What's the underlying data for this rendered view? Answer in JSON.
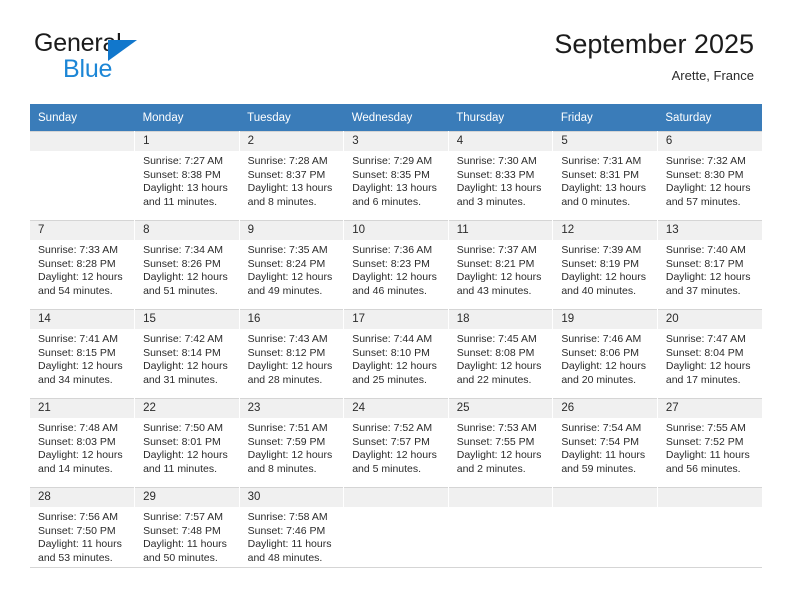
{
  "brand": {
    "name_top": "General",
    "name_bottom": "Blue",
    "triangle_color": "#1177cc",
    "blue_color": "#1c86d6"
  },
  "header": {
    "title": "September 2025",
    "location": "Arette, France"
  },
  "theme": {
    "header_row_bg": "#3a7cb9",
    "daynum_band_bg": "#f0f0f0",
    "grid_line": "#d5d5d5",
    "text": "#2b2b2b"
  },
  "weekday_headers": [
    "Sunday",
    "Monday",
    "Tuesday",
    "Wednesday",
    "Thursday",
    "Friday",
    "Saturday"
  ],
  "labels": {
    "sunrise_prefix": "Sunrise:",
    "sunset_prefix": "Sunset:",
    "daylight_prefix": "Daylight:"
  },
  "weeks": [
    [
      {
        "day": "",
        "sunrise": "",
        "sunset": "",
        "daylight": ""
      },
      {
        "day": "1",
        "sunrise": "Sunrise: 7:27 AM",
        "sunset": "Sunset: 8:38 PM",
        "daylight": "Daylight: 13 hours and 11 minutes."
      },
      {
        "day": "2",
        "sunrise": "Sunrise: 7:28 AM",
        "sunset": "Sunset: 8:37 PM",
        "daylight": "Daylight: 13 hours and 8 minutes."
      },
      {
        "day": "3",
        "sunrise": "Sunrise: 7:29 AM",
        "sunset": "Sunset: 8:35 PM",
        "daylight": "Daylight: 13 hours and 6 minutes."
      },
      {
        "day": "4",
        "sunrise": "Sunrise: 7:30 AM",
        "sunset": "Sunset: 8:33 PM",
        "daylight": "Daylight: 13 hours and 3 minutes."
      },
      {
        "day": "5",
        "sunrise": "Sunrise: 7:31 AM",
        "sunset": "Sunset: 8:31 PM",
        "daylight": "Daylight: 13 hours and 0 minutes."
      },
      {
        "day": "6",
        "sunrise": "Sunrise: 7:32 AM",
        "sunset": "Sunset: 8:30 PM",
        "daylight": "Daylight: 12 hours and 57 minutes."
      }
    ],
    [
      {
        "day": "7",
        "sunrise": "Sunrise: 7:33 AM",
        "sunset": "Sunset: 8:28 PM",
        "daylight": "Daylight: 12 hours and 54 minutes."
      },
      {
        "day": "8",
        "sunrise": "Sunrise: 7:34 AM",
        "sunset": "Sunset: 8:26 PM",
        "daylight": "Daylight: 12 hours and 51 minutes."
      },
      {
        "day": "9",
        "sunrise": "Sunrise: 7:35 AM",
        "sunset": "Sunset: 8:24 PM",
        "daylight": "Daylight: 12 hours and 49 minutes."
      },
      {
        "day": "10",
        "sunrise": "Sunrise: 7:36 AM",
        "sunset": "Sunset: 8:23 PM",
        "daylight": "Daylight: 12 hours and 46 minutes."
      },
      {
        "day": "11",
        "sunrise": "Sunrise: 7:37 AM",
        "sunset": "Sunset: 8:21 PM",
        "daylight": "Daylight: 12 hours and 43 minutes."
      },
      {
        "day": "12",
        "sunrise": "Sunrise: 7:39 AM",
        "sunset": "Sunset: 8:19 PM",
        "daylight": "Daylight: 12 hours and 40 minutes."
      },
      {
        "day": "13",
        "sunrise": "Sunrise: 7:40 AM",
        "sunset": "Sunset: 8:17 PM",
        "daylight": "Daylight: 12 hours and 37 minutes."
      }
    ],
    [
      {
        "day": "14",
        "sunrise": "Sunrise: 7:41 AM",
        "sunset": "Sunset: 8:15 PM",
        "daylight": "Daylight: 12 hours and 34 minutes."
      },
      {
        "day": "15",
        "sunrise": "Sunrise: 7:42 AM",
        "sunset": "Sunset: 8:14 PM",
        "daylight": "Daylight: 12 hours and 31 minutes."
      },
      {
        "day": "16",
        "sunrise": "Sunrise: 7:43 AM",
        "sunset": "Sunset: 8:12 PM",
        "daylight": "Daylight: 12 hours and 28 minutes."
      },
      {
        "day": "17",
        "sunrise": "Sunrise: 7:44 AM",
        "sunset": "Sunset: 8:10 PM",
        "daylight": "Daylight: 12 hours and 25 minutes."
      },
      {
        "day": "18",
        "sunrise": "Sunrise: 7:45 AM",
        "sunset": "Sunset: 8:08 PM",
        "daylight": "Daylight: 12 hours and 22 minutes."
      },
      {
        "day": "19",
        "sunrise": "Sunrise: 7:46 AM",
        "sunset": "Sunset: 8:06 PM",
        "daylight": "Daylight: 12 hours and 20 minutes."
      },
      {
        "day": "20",
        "sunrise": "Sunrise: 7:47 AM",
        "sunset": "Sunset: 8:04 PM",
        "daylight": "Daylight: 12 hours and 17 minutes."
      }
    ],
    [
      {
        "day": "21",
        "sunrise": "Sunrise: 7:48 AM",
        "sunset": "Sunset: 8:03 PM",
        "daylight": "Daylight: 12 hours and 14 minutes."
      },
      {
        "day": "22",
        "sunrise": "Sunrise: 7:50 AM",
        "sunset": "Sunset: 8:01 PM",
        "daylight": "Daylight: 12 hours and 11 minutes."
      },
      {
        "day": "23",
        "sunrise": "Sunrise: 7:51 AM",
        "sunset": "Sunset: 7:59 PM",
        "daylight": "Daylight: 12 hours and 8 minutes."
      },
      {
        "day": "24",
        "sunrise": "Sunrise: 7:52 AM",
        "sunset": "Sunset: 7:57 PM",
        "daylight": "Daylight: 12 hours and 5 minutes."
      },
      {
        "day": "25",
        "sunrise": "Sunrise: 7:53 AM",
        "sunset": "Sunset: 7:55 PM",
        "daylight": "Daylight: 12 hours and 2 minutes."
      },
      {
        "day": "26",
        "sunrise": "Sunrise: 7:54 AM",
        "sunset": "Sunset: 7:54 PM",
        "daylight": "Daylight: 11 hours and 59 minutes."
      },
      {
        "day": "27",
        "sunrise": "Sunrise: 7:55 AM",
        "sunset": "Sunset: 7:52 PM",
        "daylight": "Daylight: 11 hours and 56 minutes."
      }
    ],
    [
      {
        "day": "28",
        "sunrise": "Sunrise: 7:56 AM",
        "sunset": "Sunset: 7:50 PM",
        "daylight": "Daylight: 11 hours and 53 minutes."
      },
      {
        "day": "29",
        "sunrise": "Sunrise: 7:57 AM",
        "sunset": "Sunset: 7:48 PM",
        "daylight": "Daylight: 11 hours and 50 minutes."
      },
      {
        "day": "30",
        "sunrise": "Sunrise: 7:58 AM",
        "sunset": "Sunset: 7:46 PM",
        "daylight": "Daylight: 11 hours and 48 minutes."
      },
      {
        "day": "",
        "sunrise": "",
        "sunset": "",
        "daylight": ""
      },
      {
        "day": "",
        "sunrise": "",
        "sunset": "",
        "daylight": ""
      },
      {
        "day": "",
        "sunrise": "",
        "sunset": "",
        "daylight": ""
      },
      {
        "day": "",
        "sunrise": "",
        "sunset": "",
        "daylight": ""
      }
    ]
  ]
}
